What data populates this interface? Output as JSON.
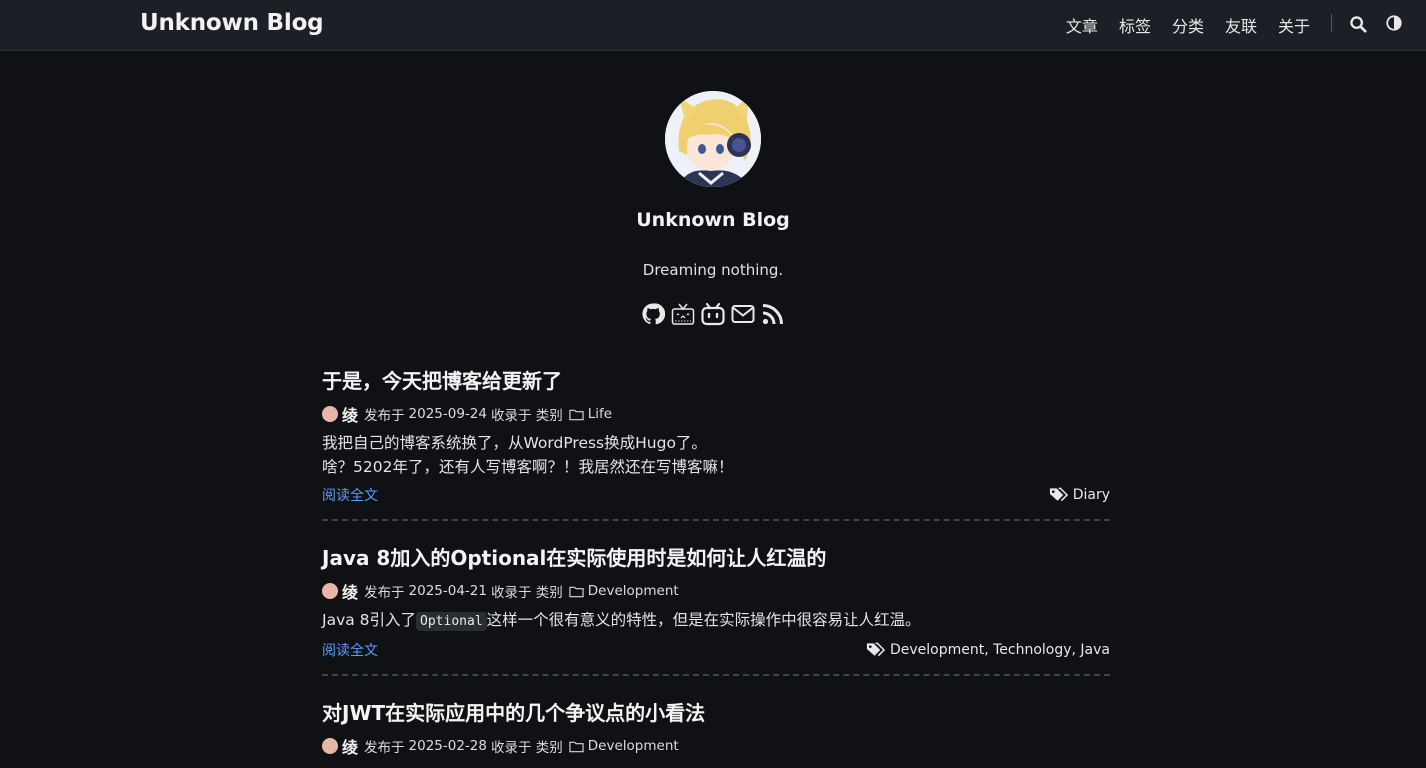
{
  "header": {
    "brand": "Unknown Blog",
    "nav": [
      "文章",
      "标签",
      "分类",
      "友联",
      "关于"
    ],
    "icons": [
      "search-icon",
      "theme-toggle-icon"
    ]
  },
  "profile": {
    "title": "Unknown Blog",
    "tagline": "Dreaming nothing.",
    "socials": [
      "github-icon",
      "tv-icon",
      "bilibili-icon",
      "mail-icon",
      "rss-icon"
    ]
  },
  "posts": [
    {
      "title": "于是，今天把博客给更新了",
      "author": "绫",
      "published_label": "发布于",
      "date": "2025-09-24",
      "category_label": "收录于 类别",
      "category": "Life",
      "summary_lines": [
        "我把自己的博客系统换了，从WordPress换成Hugo了。",
        "啥？5202年了，还有人写博客啊？！我居然还在写博客嘛！"
      ],
      "read_more": "阅读全文",
      "tags": "Diary"
    },
    {
      "title": "Java 8加入的Optional在实际使用时是如何让人红温的",
      "author": "绫",
      "published_label": "发布于",
      "date": "2025-04-21",
      "category_label": "收录于 类别",
      "category": "Development",
      "summary_pre": "Java 8引入了",
      "summary_code": "Optional",
      "summary_post": "这样一个很有意义的特性，但是在实际操作中很容易让人红温。",
      "read_more": "阅读全文",
      "tags": "Development, Technology, Java"
    },
    {
      "title": "对JWT在实际应用中的几个争议点的小看法",
      "author": "绫",
      "published_label": "发布于",
      "date": "2025-02-28",
      "category_label": "收录于 类别",
      "category": "Development"
    }
  ]
}
